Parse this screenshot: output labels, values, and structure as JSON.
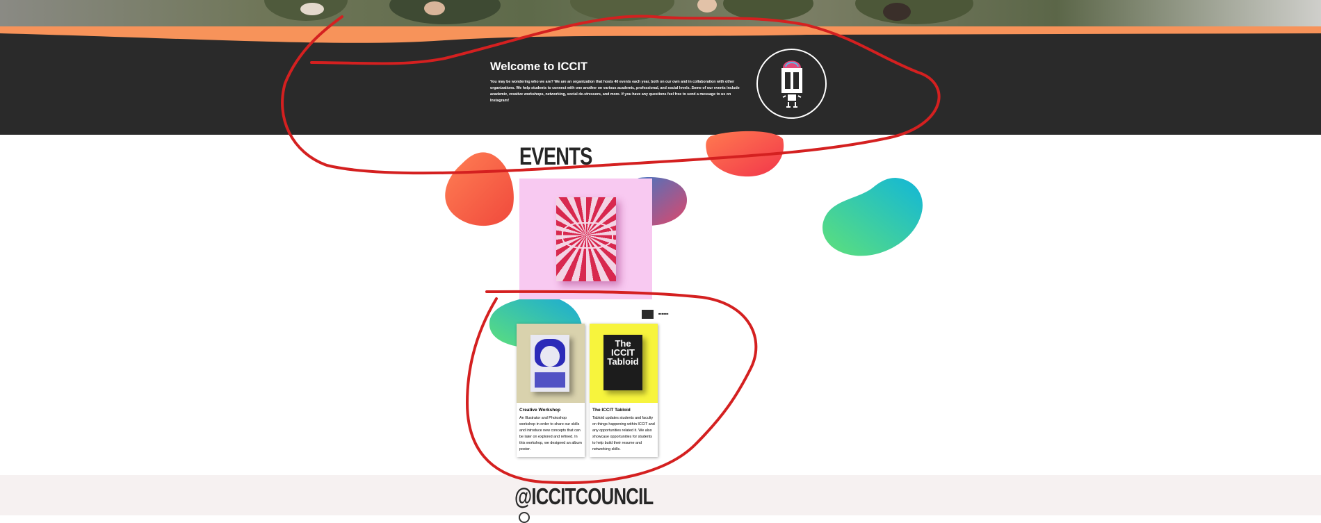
{
  "welcome": {
    "title": "Welcome to ICCIT",
    "body": "You may be wondering who we are? We are an organization that hosts 40 events each year, both on our own and in collaboration with other organizations. We help students to connect with one another on various academic, professional, and social levels. Some of our events include academic, creative workshops, networking, social de-stressors, and more. If you have any questions feel free to send a message to us on Instagram!"
  },
  "events": {
    "title": "EVENTS",
    "pager_label": "■■■■■■",
    "cards": [
      {
        "title": "Creative Workshop",
        "body": "An Illustrator and Photoshop workshop in order to share our skills and introduce new concepts that can be later on explored and refined. In this workshop, we designed an album poster."
      },
      {
        "title": "The ICCIT Tabloid",
        "body": "Tabloid updates students and faculty on things happening within ICCIT and any opportunities related it. We also showcase opportunities for students to help build their resume and networking skills.",
        "poster_text": "The ICCIT Tabloid"
      }
    ]
  },
  "footer": {
    "handle": "@ICCITCOUNCIL"
  },
  "colors": {
    "orange": "#f7935a",
    "dark": "#2a2a2a",
    "annotation": "#d42020",
    "featured_bg": "#f8c9f1"
  },
  "icons": [
    "robot-logo-icon",
    "instagram-icon"
  ]
}
